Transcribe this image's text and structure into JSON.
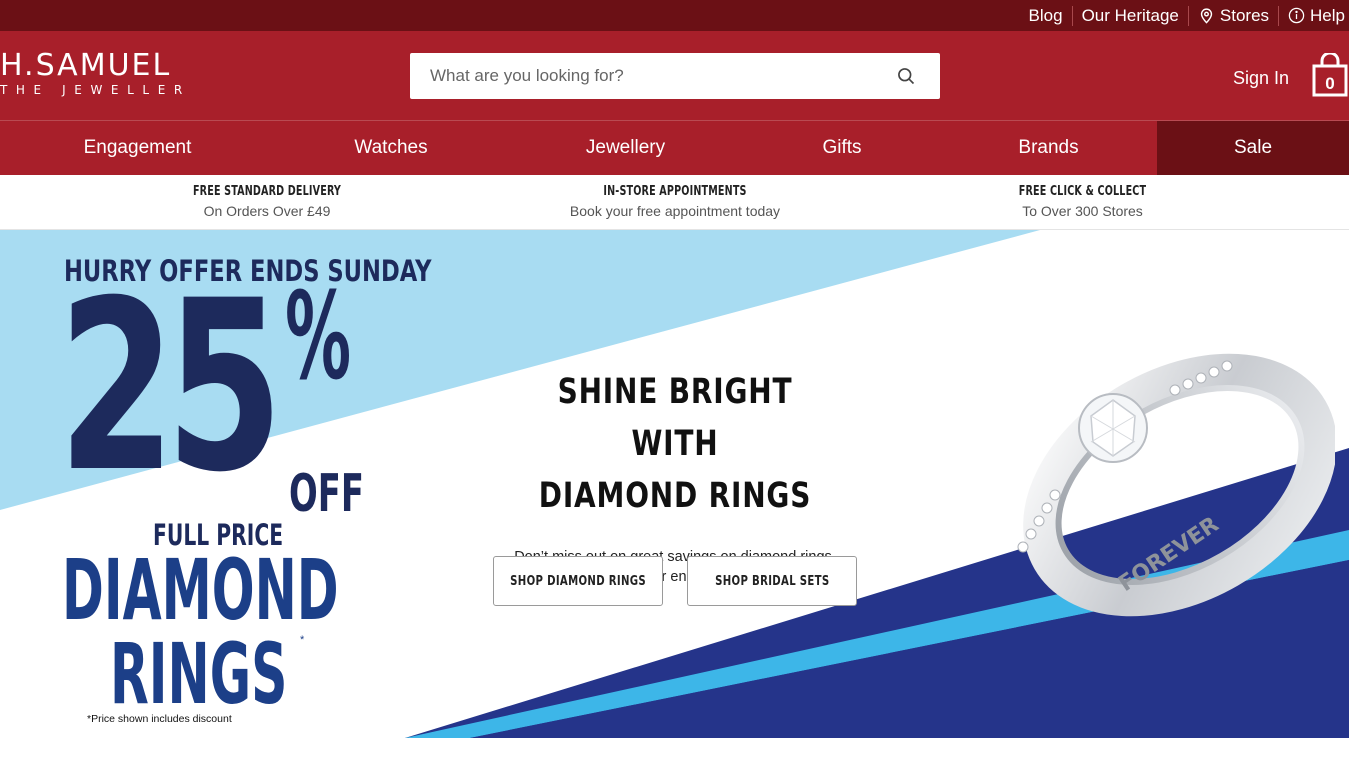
{
  "colors": {
    "topbar": "#6b1015",
    "brand_red": "#a81f2a",
    "sale_bg": "#6b1015",
    "promo_navy": "#1d2a5c",
    "promo_blue": "#1c3f88",
    "hero_light_blue": "#a8dcf2",
    "hero_dark_blue": "#25348a",
    "hero_stripe": "#3db6e8"
  },
  "topbar": {
    "links": [
      {
        "label": "Blog",
        "icon": ""
      },
      {
        "label": "Our Heritage",
        "icon": ""
      },
      {
        "label": "Stores",
        "icon": "location-pin-icon"
      },
      {
        "label": "Help",
        "icon": "info-icon"
      }
    ]
  },
  "header": {
    "logo_main": "H.SAMUEL",
    "logo_sub": "THE JEWELLER",
    "search_placeholder": "What are you looking for?",
    "search_icon": "search-icon",
    "sign_in": "Sign In",
    "bag_icon": "shopping-bag-icon",
    "bag_count": "0"
  },
  "nav": {
    "items": [
      {
        "label": "Engagement"
      },
      {
        "label": "Watches"
      },
      {
        "label": "Jewellery"
      },
      {
        "label": "Gifts"
      },
      {
        "label": "Brands"
      },
      {
        "label": "Sale"
      }
    ]
  },
  "benefits": [
    {
      "title": "FREE STANDARD DELIVERY",
      "subtitle": "On Orders Over £49"
    },
    {
      "title": "IN-STORE APPOINTMENTS",
      "subtitle": "Book your free appointment today"
    },
    {
      "title": "FREE CLICK & COLLECT",
      "subtitle": "To Over 300 Stores"
    }
  ],
  "hero": {
    "promo": {
      "hurry": "HURRY OFFER ENDS SUNDAY",
      "amount": "25",
      "percent": "%",
      "off": "OFF",
      "full_price": "FULL PRICE",
      "diamond": "DIAMOND",
      "rings": "RINGS",
      "asterisk": "*",
      "note": "*Price shown includes discount"
    },
    "headline_line1": "SHINE BRIGHT WITH",
    "headline_line2": "DIAMOND RINGS",
    "text_line1": "Don’t miss out on great savings on diamond rings.",
    "text_line2": "Hurry! Offer ends Sunday!",
    "buttons": [
      {
        "label": "SHOP DIAMOND RINGS"
      },
      {
        "label": "SHOP BRIDAL SETS"
      }
    ],
    "ring_engraving": "FOREVER"
  }
}
